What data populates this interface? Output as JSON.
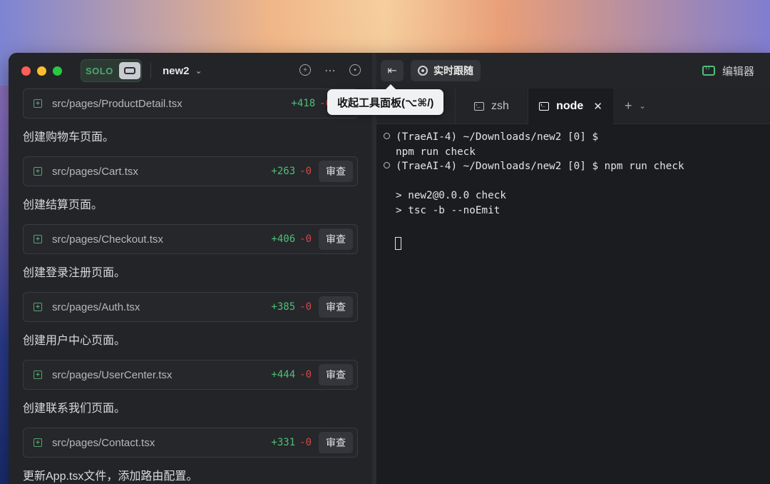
{
  "window": {
    "project_name": "new2",
    "solo_label": "SOLO"
  },
  "left_panel": {
    "changes": [
      {
        "path": "src/pages/ProductDetail.tsx",
        "adds": "+418",
        "dels": "-0",
        "review": "",
        "step_after": "创建购物车页面。"
      },
      {
        "path": "src/pages/Cart.tsx",
        "adds": "+263",
        "dels": "-0",
        "review": "审查",
        "step_after": "创建结算页面。"
      },
      {
        "path": "src/pages/Checkout.tsx",
        "adds": "+406",
        "dels": "-0",
        "review": "审查",
        "step_after": "创建登录注册页面。"
      },
      {
        "path": "src/pages/Auth.tsx",
        "adds": "+385",
        "dels": "-0",
        "review": "审查",
        "step_after": "创建用户中心页面。"
      },
      {
        "path": "src/pages/UserCenter.tsx",
        "adds": "+444",
        "dels": "-0",
        "review": "审查",
        "step_after": "创建联系我们页面。"
      },
      {
        "path": "src/pages/Contact.tsx",
        "adds": "+331",
        "dels": "-0",
        "review": "审查",
        "step_after": "更新App.tsx文件，添加路由配置。"
      }
    ]
  },
  "right_panel": {
    "follow_label": "实时跟随",
    "editor_label": "编辑器",
    "tooltip": "收起工具面板(⌥⌘/)",
    "tabs": [
      {
        "label": "zsh",
        "active": false
      },
      {
        "label": "node",
        "active": true
      }
    ],
    "add_tab_label": "+",
    "terminal_lines": [
      "(TraeAI-4) ~/Downloads/new2 [0] $",
      "npm run check",
      "(TraeAI-4) ~/Downloads/new2 [0] $ npm run check",
      "",
      "> new2@0.0.0 check",
      "> tsc -b --noEmit"
    ]
  }
}
